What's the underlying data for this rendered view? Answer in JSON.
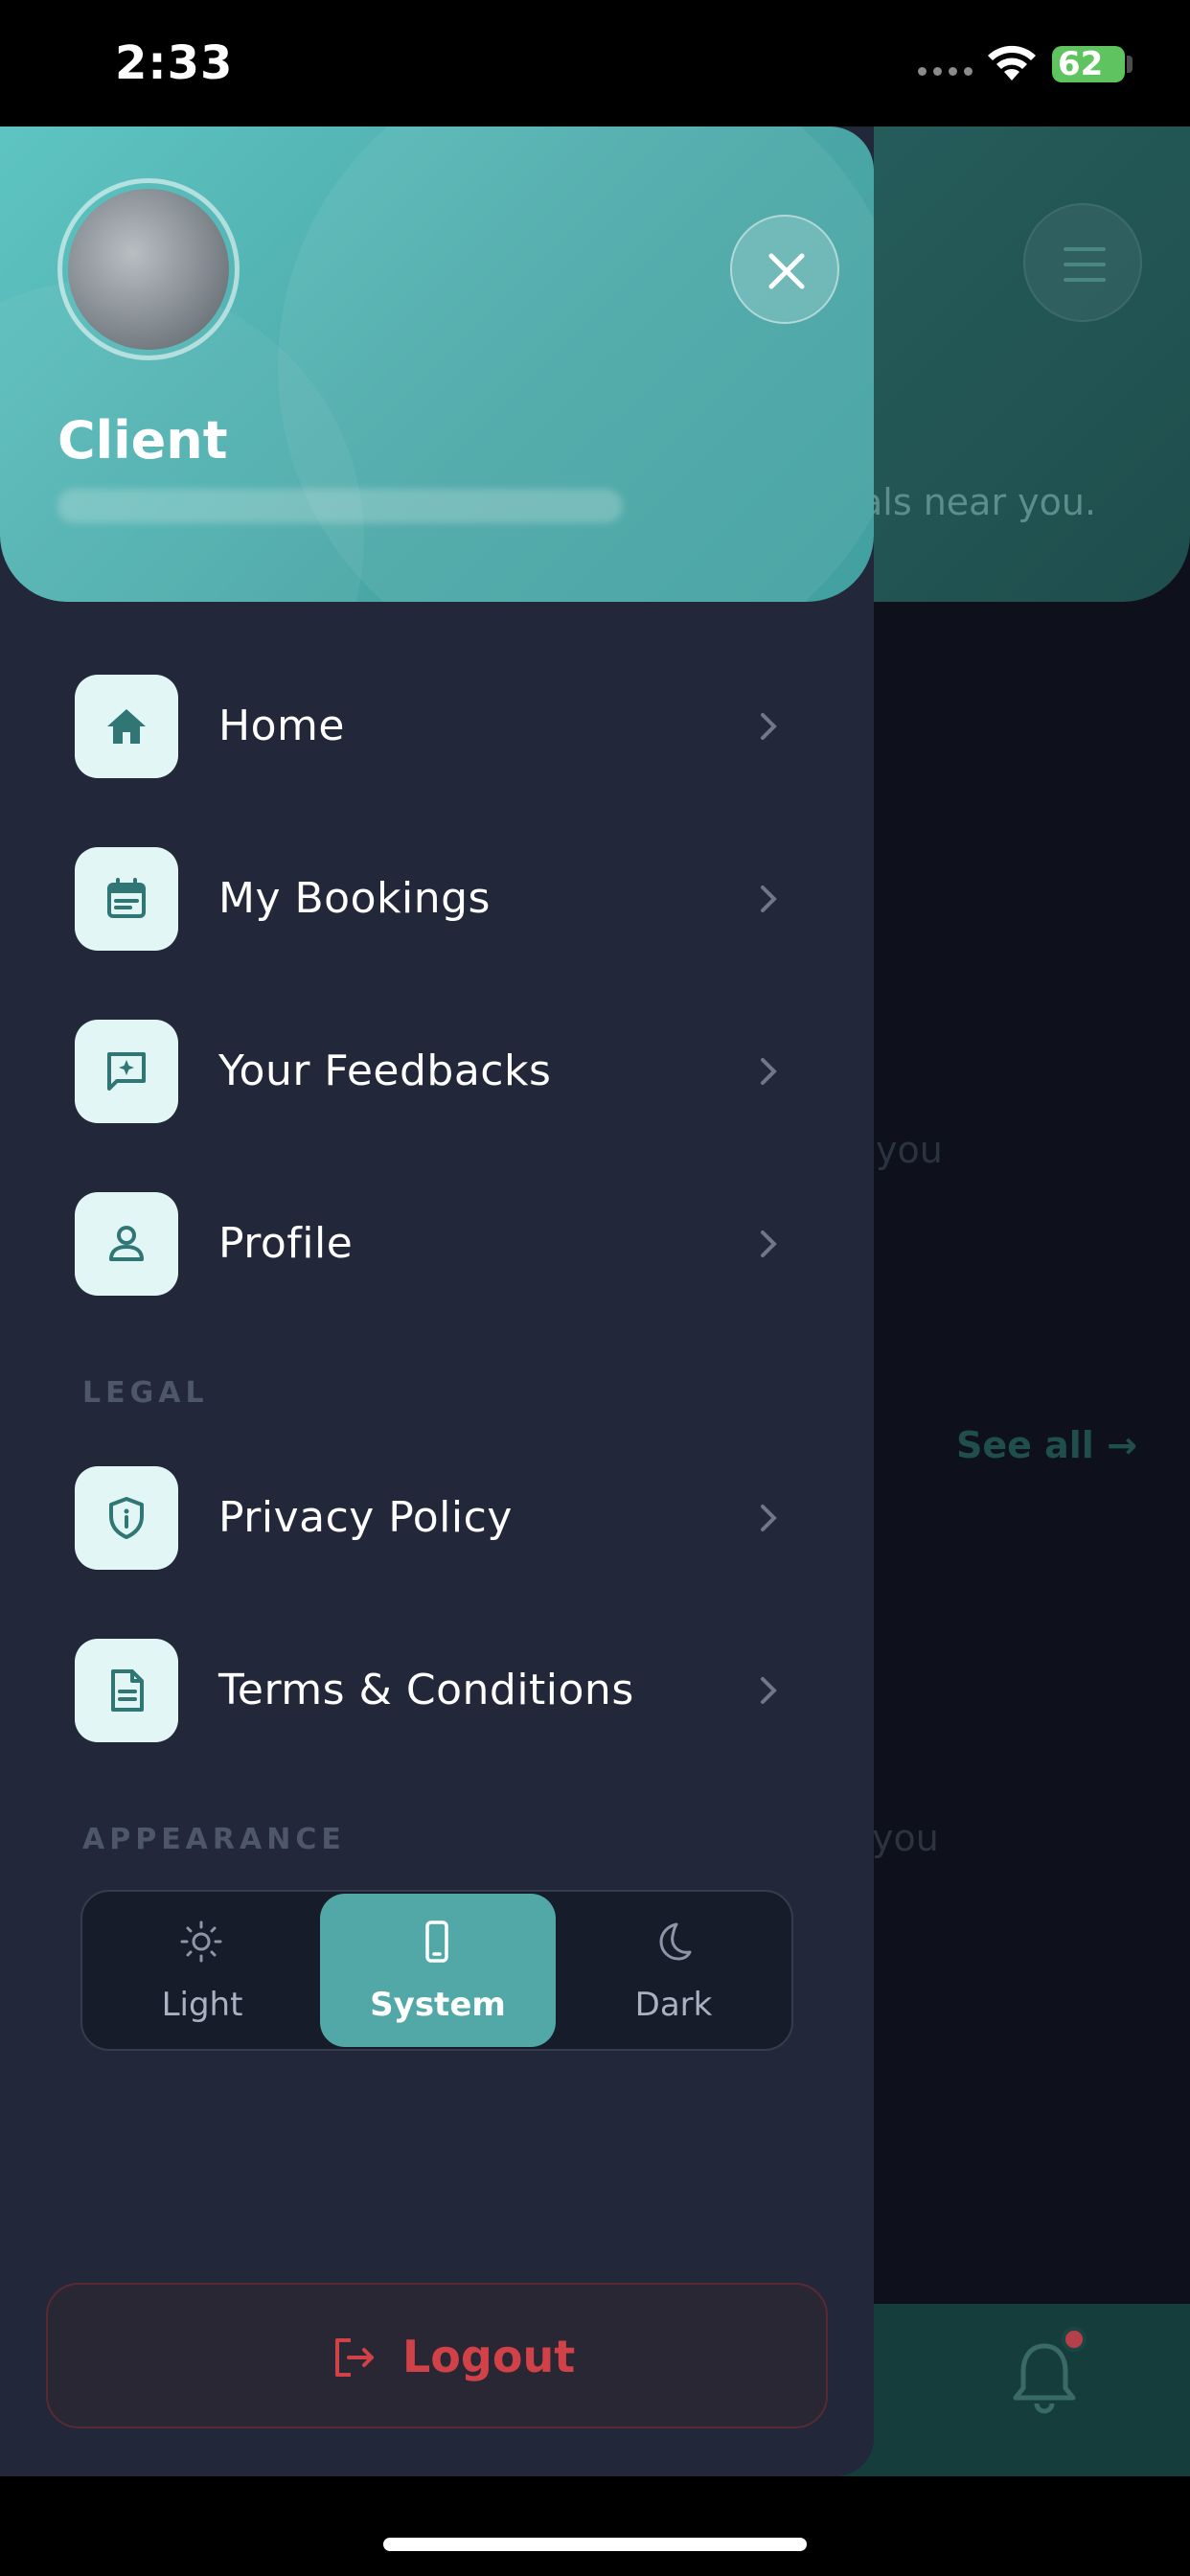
{
  "status_bar": {
    "time": "2:33",
    "battery": "62"
  },
  "background": {
    "header_snippet": "als near you.",
    "row1_snippet": "you",
    "see_all": "See all →",
    "row2_snippet": "you"
  },
  "drawer": {
    "user": {
      "name": "Client"
    },
    "menu": [
      {
        "label": "Home",
        "icon": "home-icon"
      },
      {
        "label": "My Bookings",
        "icon": "calendar-icon"
      },
      {
        "label": "Your Feedbacks",
        "icon": "feedback-icon"
      },
      {
        "label": "Profile",
        "icon": "person-icon"
      }
    ],
    "legal_heading": "LEGAL",
    "legal": [
      {
        "label": "Privacy Policy",
        "icon": "shield-icon"
      },
      {
        "label": "Terms & Conditions",
        "icon": "document-icon"
      }
    ],
    "appearance_heading": "APPEARANCE",
    "theme": {
      "options": [
        "Light",
        "System",
        "Dark"
      ],
      "selected": "System"
    },
    "logout_label": "Logout"
  },
  "colors": {
    "accent": "#52a8a7",
    "header_teal": "#5ec4c2",
    "drawer_bg": "#222839",
    "danger": "#d04148"
  }
}
